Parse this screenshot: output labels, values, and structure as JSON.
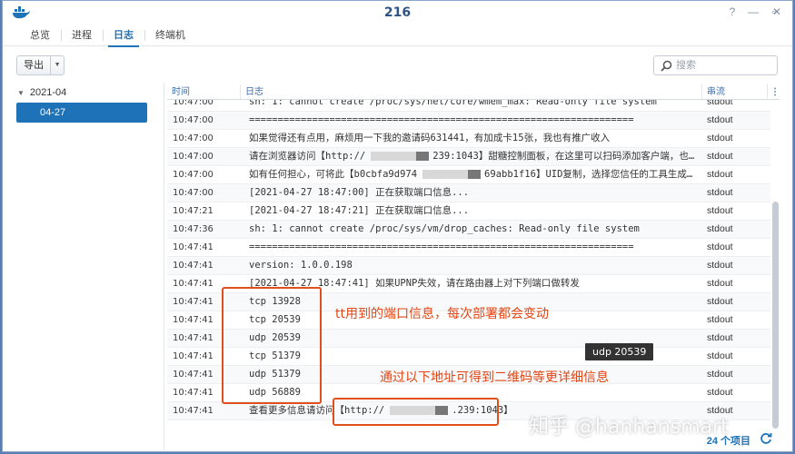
{
  "window": {
    "title": "216"
  },
  "tabs": [
    {
      "label": "总览",
      "active": false
    },
    {
      "label": "进程",
      "active": false
    },
    {
      "label": "日志",
      "active": true
    },
    {
      "label": "终端机",
      "active": false
    }
  ],
  "toolbar": {
    "export_label": "导出",
    "search_placeholder": "搜索"
  },
  "tree": {
    "root": "2021-04",
    "child": "04-27"
  },
  "grid": {
    "headers": {
      "time": "时间",
      "log": "日志",
      "stream": "串流"
    },
    "rows": [
      {
        "time": "10:47:00",
        "log": "sh: 1: cannot create /proc/sys/net/core/wmem_max: Read-only file system",
        "stream": "stdout"
      },
      {
        "time": "10:47:00",
        "log": "===================================================================",
        "stream": "stdout"
      },
      {
        "time": "10:47:00",
        "log": "如果觉得还有点用，麻烦用一下我的邀请码631441，有加成卡15张，我也有推广收入",
        "stream": "stdout"
      },
      {
        "time": "10:47:00",
        "log": "请在浏览器访问【http://",
        "log_tail": "239:1043】甜糖控制面板，在这里可以扫码添加客户端，也…",
        "stream": "stdout"
      },
      {
        "time": "10:47:00",
        "log": "如有任何担心，可将此【b0cbfa9d974",
        "log_tail": "69abb1f16】UID复制，选择您信任的工具生成…",
        "stream": "stdout"
      },
      {
        "time": "10:47:00",
        "log": "[2021-04-27 18:47:00] 正在获取端口信息...",
        "stream": "stdout"
      },
      {
        "time": "10:47:21",
        "log": "[2021-04-27 18:47:21] 正在获取端口信息...",
        "stream": "stdout"
      },
      {
        "time": "10:47:36",
        "log": "sh: 1: cannot create /proc/sys/vm/drop_caches: Read-only file system",
        "stream": "stdout"
      },
      {
        "time": "10:47:41",
        "log": "===================================================================",
        "stream": "stdout"
      },
      {
        "time": "10:47:41",
        "log": "version: 1.0.0.198",
        "stream": "stdout"
      },
      {
        "time": "10:47:41",
        "log": "[2021-04-27 18:47:41] 如果UPNP失效，请在路由器上对下列端口做转发",
        "stream": "stdout"
      },
      {
        "time": "10:47:41",
        "log": "tcp 13928",
        "stream": "stdout"
      },
      {
        "time": "10:47:41",
        "log": "tcp 20539",
        "stream": "stdout"
      },
      {
        "time": "10:47:41",
        "log": "udp 20539",
        "stream": "stdout"
      },
      {
        "time": "10:47:41",
        "log": "tcp 51379",
        "stream": "stdout"
      },
      {
        "time": "10:47:41",
        "log": "udp 51379",
        "stream": "stdout"
      },
      {
        "time": "10:47:41",
        "log": "udp 56889",
        "stream": "stdout"
      },
      {
        "time": "10:47:41",
        "log": "查看更多信息请访问【http://",
        "log_tail": ".239:1043】",
        "stream": "stdout"
      }
    ]
  },
  "footer": {
    "count": "24 个项目"
  },
  "tooltip": "udp 20539",
  "annotations": {
    "ports_note": "tt用到的端口信息，每次部署都会变动",
    "qr_note": "通过以下地址可得到二维码等更详细信息"
  },
  "watermark": "知乎 @hanhansmart",
  "colors": {
    "accent": "#1d72b8",
    "annotation": "#e24614"
  }
}
